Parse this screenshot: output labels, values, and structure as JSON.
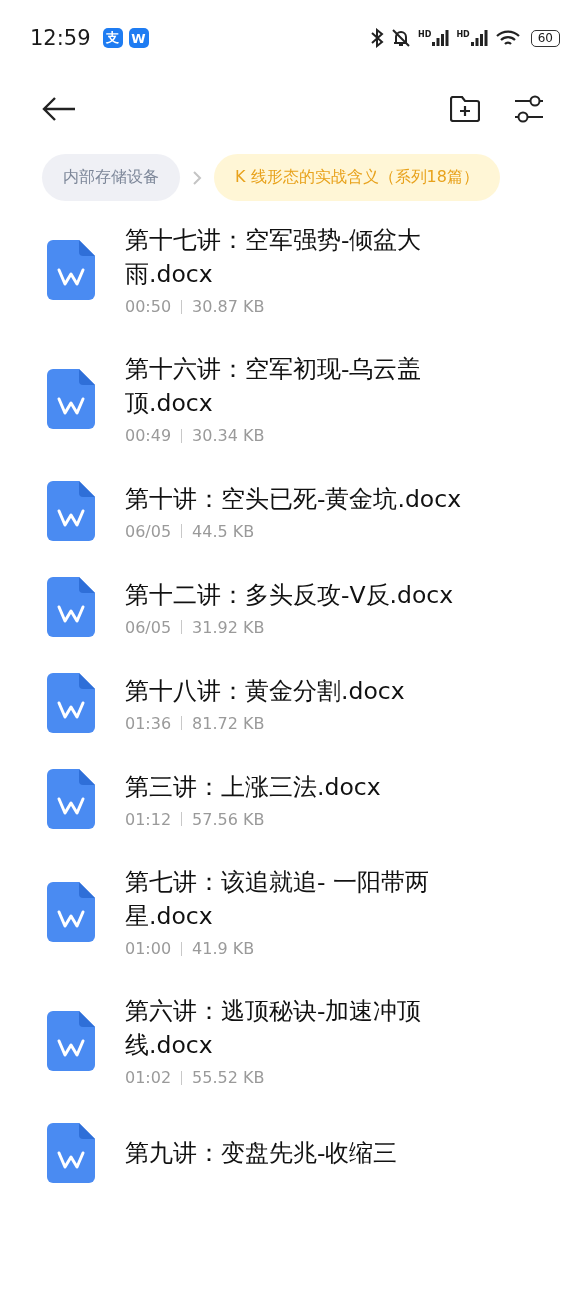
{
  "status_bar": {
    "time": "12:59",
    "app_badges": [
      "支",
      "W"
    ],
    "signals": [
      {
        "label": "HD"
      },
      {
        "label": "HD"
      }
    ],
    "battery": "60"
  },
  "breadcrumbs": [
    {
      "label": "内部存储设备",
      "selected": false
    },
    {
      "label": "K 线形态的实战含义（系列18篇）",
      "selected": true
    }
  ],
  "files": [
    {
      "name": "第十七讲：空军强势-倾盆大雨.docx",
      "time": "00:50",
      "size": "30.87 KB"
    },
    {
      "name": "第十六讲：空军初现-乌云盖顶.docx",
      "time": "00:49",
      "size": "30.34 KB"
    },
    {
      "name": "第十讲：空头已死-黄金坑.docx",
      "time": "06/05",
      "size": "44.5 KB"
    },
    {
      "name": "第十二讲：多头反攻-V反.docx",
      "time": "06/05",
      "size": "31.92 KB"
    },
    {
      "name": "第十八讲：黄金分割.docx",
      "time": "01:36",
      "size": "81.72 KB"
    },
    {
      "name": "第三讲：上涨三法.docx",
      "time": "01:12",
      "size": "57.56 KB"
    },
    {
      "name": "第七讲：该追就追- 一阳带两星.docx",
      "time": "01:00",
      "size": "41.9 KB"
    },
    {
      "name": "第六讲：逃顶秘诀-加速冲顶线.docx",
      "time": "01:02",
      "size": "55.52 KB"
    },
    {
      "name": "第九讲：变盘先兆-收缩三"
    }
  ]
}
